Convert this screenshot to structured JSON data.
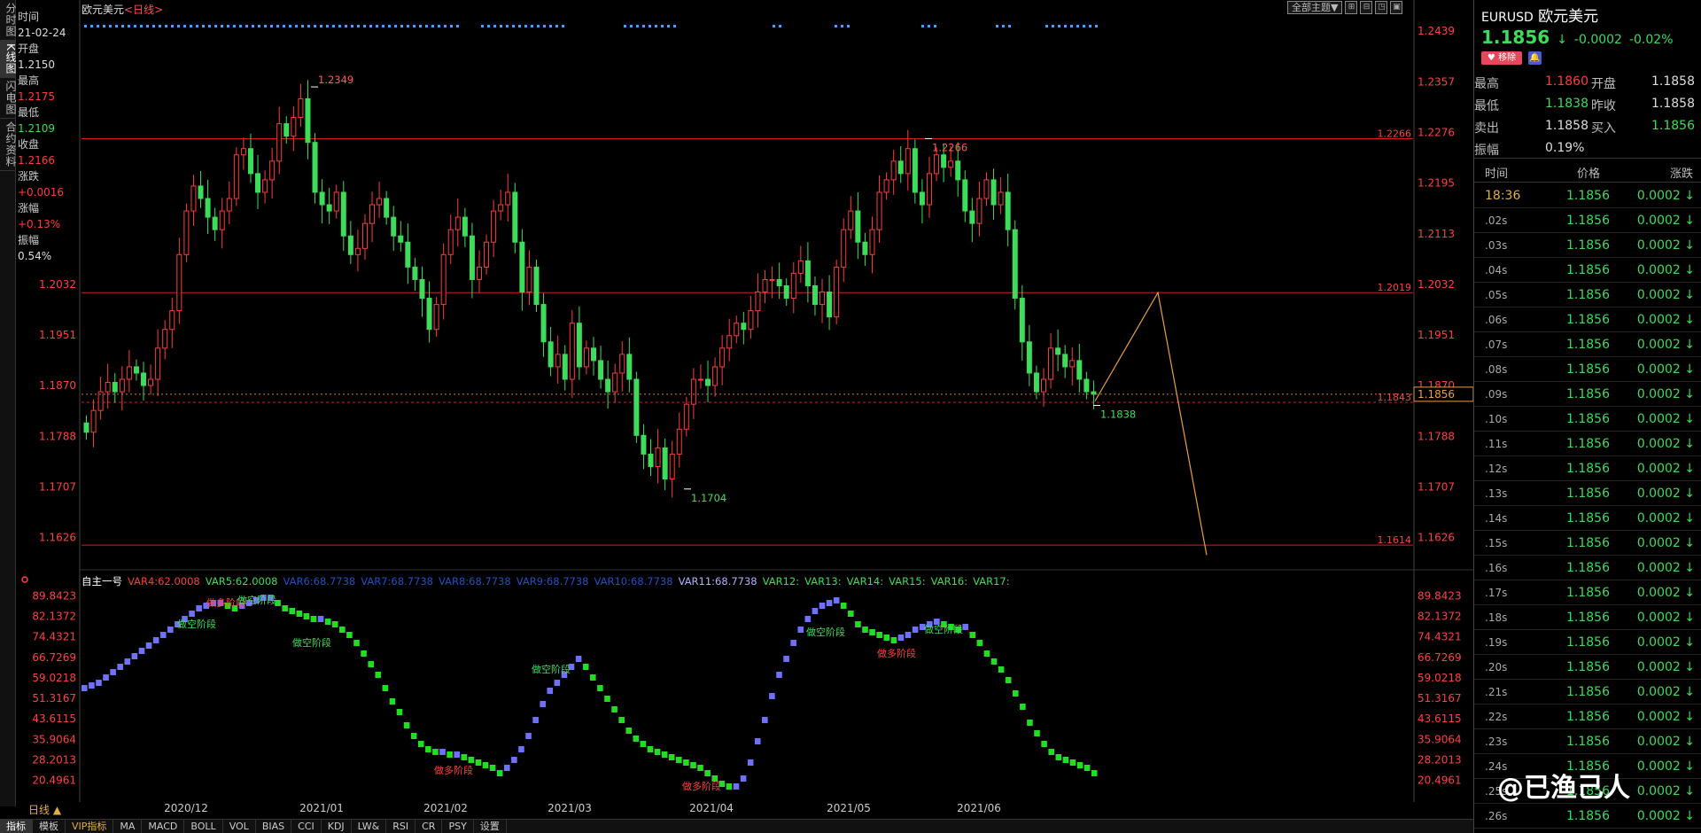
{
  "left_tabs": [
    "分时图",
    "K线图",
    "闪电图",
    "合约资料"
  ],
  "info_panel": [
    {
      "label": "时间",
      "value": "21-02-24",
      "color": "white"
    },
    {
      "label": "开盘",
      "value": "1.2150",
      "color": "white"
    },
    {
      "label": "最高",
      "value": "1.2175",
      "color": "red"
    },
    {
      "label": "最低",
      "value": "1.2109",
      "color": "green"
    },
    {
      "label": "收盘",
      "value": "1.2166",
      "color": "red"
    },
    {
      "label": "涨跌",
      "value": "+0.0016",
      "color": "red"
    },
    {
      "label": "涨幅",
      "value": "+0.13%",
      "color": "red"
    },
    {
      "label": "振幅",
      "value": "0.54%",
      "color": "white"
    }
  ],
  "chart_header": {
    "title": "欧元美元",
    "period": "<日线>",
    "theme_btn": "全部主题▼",
    "tool_btns": [
      "⊞",
      "⊟",
      "◳",
      "▣"
    ]
  },
  "chart_data": {
    "type": "candlestick",
    "y_ticks": [
      "1.2439",
      "1.2357",
      "1.2276",
      "1.2195",
      "1.2113",
      "1.2032",
      "1.1951",
      "1.1870",
      "1.1788",
      "1.1707",
      "1.1626"
    ],
    "left_y_ticks": [
      "1.2032",
      "1.1951",
      "1.1870",
      "1.1788",
      "1.1707",
      "1.1626"
    ],
    "x_labels": [
      "2020/12",
      "2021/01",
      "2021/02",
      "2021/03",
      "2021/04",
      "2021/05",
      "2021/06"
    ],
    "annotations": [
      {
        "text": "1.2349",
        "color": "#ff5a5a"
      },
      {
        "text": "1.2266",
        "color": "#ff5a5a"
      },
      {
        "text": "1.1704",
        "color": "#3ddc5a"
      },
      {
        "text": "1.1838",
        "color": "#3ddc5a"
      }
    ],
    "horizontal_lines": [
      {
        "value": 1.2266,
        "label": "1.2266"
      },
      {
        "value": 1.2019,
        "label": "1.2019"
      },
      {
        "value": 1.1843,
        "label": "1.1843"
      },
      {
        "value": 1.1614,
        "label": "1.1614"
      }
    ],
    "current_price_box": "1.1856",
    "ylim": [
      1.159,
      1.246
    ],
    "closes": [
      1.1795,
      1.183,
      1.186,
      1.1875,
      1.186,
      1.188,
      1.19,
      1.189,
      1.187,
      1.188,
      1.193,
      1.196,
      1.199,
      1.208,
      1.215,
      1.219,
      1.217,
      1.214,
      1.212,
      1.215,
      1.217,
      1.224,
      1.225,
      1.221,
      1.218,
      1.22,
      1.223,
      1.229,
      1.227,
      1.23,
      1.233,
      1.226,
      1.218,
      1.216,
      1.215,
      1.218,
      1.211,
      1.208,
      1.209,
      1.213,
      1.216,
      1.217,
      1.214,
      1.211,
      1.21,
      1.206,
      1.204,
      1.201,
      1.196,
      1.2,
      1.208,
      1.212,
      1.214,
      1.211,
      1.204,
      1.206,
      1.21,
      1.215,
      1.216,
      1.218,
      1.21,
      1.202,
      1.206,
      1.2,
      1.194,
      1.19,
      1.192,
      1.188,
      1.197,
      1.19,
      1.193,
      1.191,
      1.188,
      1.186,
      1.189,
      1.192,
      1.188,
      1.179,
      1.176,
      1.174,
      1.177,
      1.172,
      1.176,
      1.18,
      1.184,
      1.188,
      1.188,
      1.187,
      1.19,
      1.193,
      1.195,
      1.197,
      1.196,
      1.199,
      1.202,
      1.204,
      1.204,
      1.203,
      1.201,
      1.205,
      1.207,
      1.203,
      1.2,
      1.202,
      1.198,
      1.206,
      1.212,
      1.215,
      1.21,
      1.208,
      1.212,
      1.218,
      1.22,
      1.223,
      1.221,
      1.225,
      1.218,
      1.216,
      1.221,
      1.224,
      1.222,
      1.223,
      1.22,
      1.215,
      1.213,
      1.217,
      1.22,
      1.216,
      1.218,
      1.212,
      1.201,
      1.194,
      1.189,
      1.186,
      1.188,
      1.193,
      1.192,
      1.19,
      1.191,
      1.188,
      1.186,
      1.1856
    ],
    "indicator": {
      "name": "自主一号",
      "vars": [
        {
          "text": "VAR4:62.0008",
          "color": "#ff3b3b"
        },
        {
          "text": "VAR5:62.0008",
          "color": "#3ddc5a"
        },
        {
          "text": "VAR6:68.7738",
          "color": "#2050c8"
        },
        {
          "text": "VAR7:68.7738",
          "color": "#2050c8"
        },
        {
          "text": "VAR8:68.7738",
          "color": "#2050c8"
        },
        {
          "text": "VAR9:68.7738",
          "color": "#2050c8"
        },
        {
          "text": "VAR10:68.7738",
          "color": "#2050c8"
        },
        {
          "text": "VAR11:68.7738",
          "color": "#b0b0ff"
        },
        {
          "text": "VAR12:",
          "color": "#3ddc5a"
        },
        {
          "text": "VAR13:",
          "color": "#3ddc5a"
        },
        {
          "text": "VAR14:",
          "color": "#3ddc5a"
        },
        {
          "text": "VAR15:",
          "color": "#3ddc5a"
        },
        {
          "text": "VAR16:",
          "color": "#3ddc5a"
        },
        {
          "text": "VAR17:",
          "color": "#3ddc5a"
        }
      ],
      "y_ticks": [
        "89.8423",
        "82.1372",
        "74.4321",
        "66.7269",
        "59.0218",
        "51.3167",
        "43.6115",
        "35.9064",
        "28.2013",
        "20.4961"
      ],
      "ylim": [
        14,
        92
      ],
      "labels": [
        "做空阶段",
        "做多阶段",
        "做空阶段",
        "做空阶段",
        "做多阶段",
        "做空阶段",
        "做多阶段",
        "做空阶段",
        "做多阶段",
        "做空阶段"
      ],
      "values": [
        54,
        55,
        56,
        58,
        60,
        62,
        64,
        66,
        68,
        70,
        72,
        74,
        76,
        78,
        80,
        82,
        84,
        85,
        86,
        86,
        85,
        84,
        85,
        86,
        87,
        88,
        88,
        86,
        84,
        83,
        82,
        81,
        80,
        80,
        79,
        78,
        76,
        74,
        71,
        67,
        63,
        59,
        54,
        49,
        45,
        40,
        36,
        33,
        31,
        30,
        30,
        29,
        29,
        28,
        27,
        26,
        25,
        24,
        22,
        24,
        27,
        31,
        36,
        42,
        48,
        53,
        56,
        59,
        62,
        65,
        62,
        58,
        54,
        50,
        46,
        42,
        38,
        35,
        33,
        31,
        30,
        29,
        28,
        27,
        26,
        25,
        24,
        22,
        20,
        18,
        17,
        17,
        20,
        26,
        34,
        42,
        51,
        59,
        65,
        71,
        76,
        80,
        83,
        85,
        86,
        87,
        85,
        82,
        78,
        76,
        75,
        74,
        73,
        72,
        73,
        74,
        76,
        77,
        78,
        79,
        78,
        77,
        76,
        77,
        74,
        71,
        67,
        64,
        61,
        57,
        52,
        47,
        41,
        37,
        33,
        30,
        28,
        27,
        26,
        25,
        24,
        22
      ]
    }
  },
  "bottom": {
    "period_label": "日线 ▲",
    "tabs": [
      "指标",
      "模板",
      "VIP指标",
      "MA",
      "MACD",
      "BOLL",
      "VOL",
      "BIAS",
      "CCI",
      "KDJ",
      "LW&",
      "RSI",
      "CR",
      "PSY",
      "设置"
    ]
  },
  "right_panel": {
    "code": "EURUSD",
    "name": "欧元美元",
    "price": "1.1856",
    "arrow": "↓",
    "change": "-0.0002",
    "pct": "-0.02%",
    "remove_btn": "♥ 移除",
    "bell_btn": "🔔",
    "stats": [
      {
        "l1": "最高",
        "v1": "1.1860",
        "c1": "red",
        "l2": "开盘",
        "v2": "1.1858",
        "c2": "white"
      },
      {
        "l1": "最低",
        "v1": "1.1838",
        "c1": "green",
        "l2": "昨收",
        "v2": "1.1858",
        "c2": "white"
      },
      {
        "l1": "卖出",
        "v1": "1.1858",
        "c1": "white",
        "l2": "买入",
        "v2": "1.1856",
        "c2": "green"
      },
      {
        "l1": "振幅",
        "v1": "0.19%",
        "c1": "white",
        "l2": "",
        "v2": "",
        "c2": "white"
      }
    ],
    "tick_headers": {
      "time": "时间",
      "price": "价格",
      "change": "涨跌"
    },
    "ticks": [
      {
        "t": "18:36",
        "p": "1.1856",
        "c": "0.0002 ↓"
      },
      {
        "t": ".02s",
        "p": "1.1856",
        "c": "0.0002 ↓"
      },
      {
        "t": ".03s",
        "p": "1.1856",
        "c": "0.0002 ↓"
      },
      {
        "t": ".04s",
        "p": "1.1856",
        "c": "0.0002 ↓"
      },
      {
        "t": ".05s",
        "p": "1.1856",
        "c": "0.0002 ↓"
      },
      {
        "t": ".06s",
        "p": "1.1856",
        "c": "0.0002 ↓"
      },
      {
        "t": ".07s",
        "p": "1.1856",
        "c": "0.0002 ↓"
      },
      {
        "t": ".08s",
        "p": "1.1856",
        "c": "0.0002 ↓"
      },
      {
        "t": ".09s",
        "p": "1.1856",
        "c": "0.0002 ↓"
      },
      {
        "t": ".10s",
        "p": "1.1856",
        "c": "0.0002 ↓"
      },
      {
        "t": ".11s",
        "p": "1.1856",
        "c": "0.0002 ↓"
      },
      {
        "t": ".12s",
        "p": "1.1856",
        "c": "0.0002 ↓"
      },
      {
        "t": ".13s",
        "p": "1.1856",
        "c": "0.0002 ↓"
      },
      {
        "t": ".14s",
        "p": "1.1856",
        "c": "0.0002 ↓"
      },
      {
        "t": ".15s",
        "p": "1.1856",
        "c": "0.0002 ↓"
      },
      {
        "t": ".16s",
        "p": "1.1856",
        "c": "0.0002 ↓"
      },
      {
        "t": ".17s",
        "p": "1.1856",
        "c": "0.0002 ↓"
      },
      {
        "t": ".18s",
        "p": "1.1856",
        "c": "0.0002 ↓"
      },
      {
        "t": ".19s",
        "p": "1.1856",
        "c": "0.0002 ↓"
      },
      {
        "t": ".20s",
        "p": "1.1856",
        "c": "0.0002 ↓"
      },
      {
        "t": ".21s",
        "p": "1.1856",
        "c": "0.0002 ↓"
      },
      {
        "t": ".22s",
        "p": "1.1856",
        "c": "0.0002 ↓"
      },
      {
        "t": ".23s",
        "p": "1.1856",
        "c": "0.0002 ↓"
      },
      {
        "t": ".24s",
        "p": "1.1856",
        "c": "0.0002 ↓"
      },
      {
        "t": ".25s",
        "p": "1.1856",
        "c": "0.0002 ↓"
      },
      {
        "t": ".26s",
        "p": "1.1856",
        "c": "0.0002 ↓"
      }
    ],
    "watermark": "@已渔己人"
  },
  "colors": {
    "up": "#ff3b3b",
    "down": "#3ddc5a",
    "line": "#d02020",
    "proj": "#e8a040",
    "ind_up": "#7070ff",
    "ind_down": "#22dd22"
  }
}
